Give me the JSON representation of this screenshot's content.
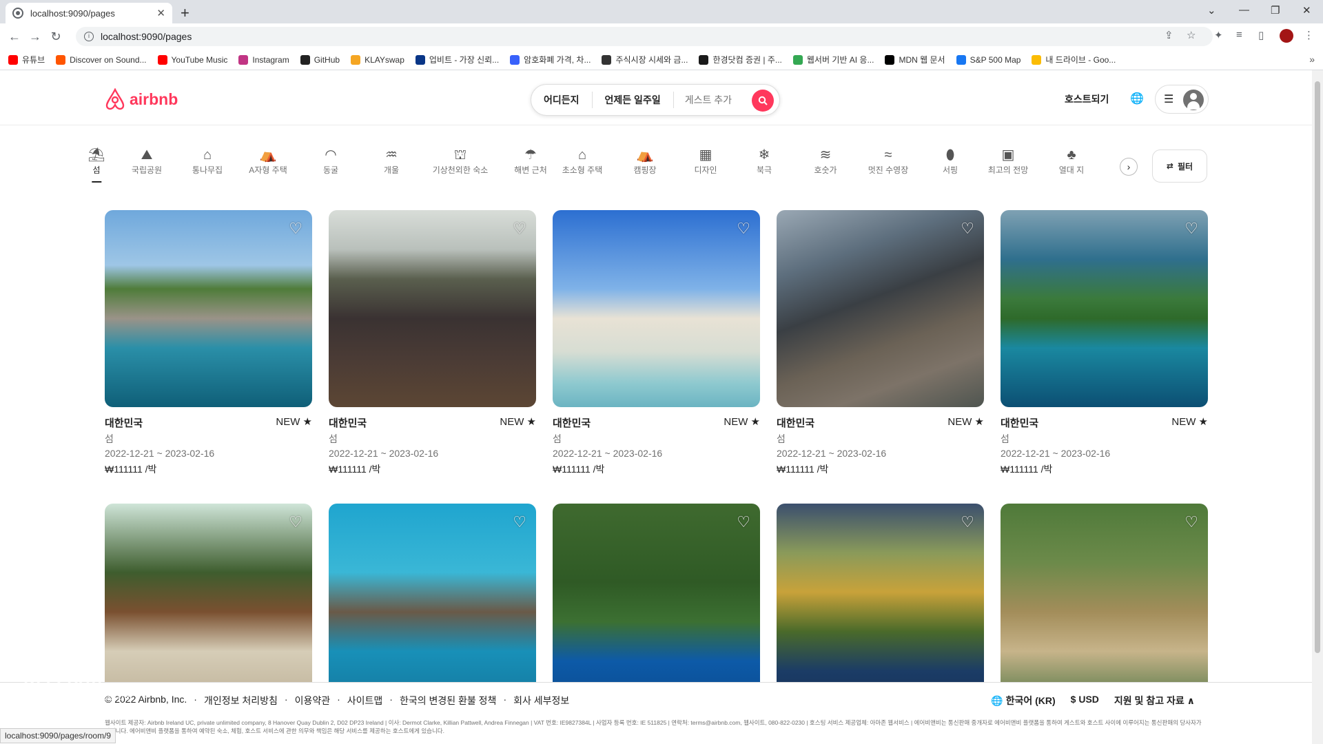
{
  "browser": {
    "tab_title": "localhost:9090/pages",
    "url": "localhost:9090/pages",
    "status_url": "localhost:9090/pages/room/9",
    "bookmarks": [
      {
        "label": "유튜브",
        "color": "#ff0000"
      },
      {
        "label": "Discover on Sound...",
        "color": "#ff5500"
      },
      {
        "label": "YouTube Music",
        "color": "#ff0000"
      },
      {
        "label": "Instagram",
        "color": "#c13584"
      },
      {
        "label": "GitHub",
        "color": "#222222"
      },
      {
        "label": "KLAYswap",
        "color": "#f5a623"
      },
      {
        "label": "업비트 - 가장 신뢰...",
        "color": "#093687"
      },
      {
        "label": "암호화폐 가격, 차...",
        "color": "#3861fb"
      },
      {
        "label": "주식시장 시세와 금...",
        "color": "#333333"
      },
      {
        "label": "한경닷컴 증권 | 주...",
        "color": "#1a1a1a"
      },
      {
        "label": "웹서버 기반 AI 응...",
        "color": "#34a853"
      },
      {
        "label": "MDN 웹 문서",
        "color": "#000000"
      },
      {
        "label": "S&P 500 Map",
        "color": "#1877f2"
      },
      {
        "label": "내 드라이브 - Goo...",
        "color": "#fbbc04"
      }
    ]
  },
  "header": {
    "logo": "airbnb",
    "search_where": "어디든지",
    "search_when": "언제든 일주일",
    "search_guest": "게스트 추가",
    "host_label": "호스트되기",
    "brand_color": "#ff385c"
  },
  "categories": [
    {
      "label": "섬",
      "icon": "⛱",
      "active": true
    },
    {
      "label": "국립공원",
      "icon": "⛰"
    },
    {
      "label": "통나무집",
      "icon": "⌂"
    },
    {
      "label": "A자형 주택",
      "icon": "⛺"
    },
    {
      "label": "동굴",
      "icon": "◠"
    },
    {
      "label": "개울",
      "icon": "♒"
    },
    {
      "label": "기상천외한 숙소",
      "icon": "⛫"
    },
    {
      "label": "해변 근처",
      "icon": "☂"
    },
    {
      "label": "초소형 주택",
      "icon": "⌂"
    },
    {
      "label": "캠핑장",
      "icon": "⛺"
    },
    {
      "label": "디자인",
      "icon": "▦"
    },
    {
      "label": "북극",
      "icon": "❄"
    },
    {
      "label": "호숫가",
      "icon": "≋"
    },
    {
      "label": "멋진 수영장",
      "icon": "≈"
    },
    {
      "label": "서핑",
      "icon": "⬮"
    },
    {
      "label": "최고의 전망",
      "icon": "▣"
    },
    {
      "label": "열대 지",
      "icon": "♣"
    }
  ],
  "filter_label": "필터",
  "listings": [
    {
      "location": "대한민국",
      "badge": "NEW ★",
      "type": "섬",
      "dates": "2022-12-21 ~ 2023-02-16",
      "price": "₩111111 /박",
      "bg": "linear-gradient(180deg,#6fa8dc 0%,#9ec6e6 28%,#4f7c3a 40%,#9a9388 55%,#2a8fa8 70%,#0f5f78 100%)"
    },
    {
      "location": "대한민국",
      "badge": "NEW ★",
      "type": "섬",
      "dates": "2022-12-21 ~ 2023-02-16",
      "price": "₩111111 /박",
      "bg": "linear-gradient(180deg,#d8ddd8 0%,#b9c0bb 20%,#5a5f4e 35%,#3a3232 55%,#4a3b35 75%,#5c4634 100%)"
    },
    {
      "location": "대한민국",
      "badge": "NEW ★",
      "type": "섬",
      "dates": "2022-12-21 ~ 2023-02-16",
      "price": "₩111111 /박",
      "bg": "linear-gradient(180deg,#2c6fd1 0%,#7fb2e8 40%,#e8e2d5 55%,#d7ddd3 72%,#8ec9cf 88%,#6bb4c2 100%)"
    },
    {
      "location": "대한민국",
      "badge": "NEW ★",
      "type": "섬",
      "dates": "2022-12-21 ~ 2023-02-16",
      "price": "₩111111 /박",
      "bg": "linear-gradient(160deg,#9aa8b4 0%,#5d6e7d 25%,#3a3f44 45%,#6b6256 65%,#7d7368 80%,#4f5550 100%)"
    },
    {
      "location": "대한민국",
      "badge": "NEW ★",
      "type": "섬",
      "dates": "2022-12-21 ~ 2023-02-16",
      "price": "₩111111 /박",
      "bg": "linear-gradient(180deg,#7fa1b3 0%,#2f6f8d 25%,#3b7a3c 45%,#2e6a2a 55%,#1a88a0 70%,#0c4f73 100%)"
    },
    {
      "location": "",
      "badge": "",
      "type": "",
      "dates": "",
      "price": "",
      "bg": "linear-gradient(180deg,#cfe5d8 0%,#3e5d2e 35%,#7a5030 55%,#d6cdb7 75%,#bfb39a 100%)"
    },
    {
      "location": "",
      "badge": "",
      "type": "",
      "dates": "",
      "price": "",
      "bg": "linear-gradient(180deg,#1fa5cf 0%,#3ab7d6 35%,#6a5a48 55%,#1890b8 75%,#147aa0 100%)"
    },
    {
      "location": "",
      "badge": "",
      "type": "",
      "dates": "",
      "price": "",
      "bg": "linear-gradient(180deg,#3f6a2f 0%,#2f5a25 40%,#3c7032 60%,#0d5aa8 80%,#0b4d92 100%)"
    },
    {
      "location": "",
      "badge": "",
      "type": "",
      "dates": "",
      "price": "",
      "bg": "linear-gradient(180deg,#3b4f6e 0%,#8a9a5a 25%,#c8a23a 45%,#4a6a2a 65%,#1b3c66 85%,#16325a 100%)"
    },
    {
      "location": "",
      "badge": "",
      "type": "",
      "dates": "",
      "price": "",
      "bg": "linear-gradient(180deg,#4f7a3a 0%,#6c8a4a 30%,#a38d5a 55%,#c7b48a 75%,#5a7a4a 100%)"
    }
  ],
  "footer": {
    "links": [
      "© 2022 Airbnb, Inc.",
      "·",
      "개인정보 처리방침",
      "·",
      "이용약관",
      "·",
      "사이트맵",
      "·",
      "한국의 변경된 환불 정책",
      "·",
      "회사 세부정보"
    ],
    "language": "🌐 한국어 (KR)",
    "currency": "$ USD",
    "support": "지원 및 참고 자료 ∧",
    "legal": "웹사이트 제공자: Airbnb Ireland UC, private unlimited company, 8 Hanover Quay Dublin 2, D02 DP23 Ireland | 이사: Dermot Clarke, Killian Pattwell, Andrea Finnegan | VAT 번호: IE9827384L | 사업자 등록 번호: IE 511825 | 연락처: terms@airbnb.com, 웹사이트, 080-822-0230 | 호스팅 서비스 제공업체: 아마존 웹서비스 | 에어비앤비는 통신판매 중개자로 에어비앤비 플랫폼을 통하여 게스트와 호스트 사이에 이루어지는 통신판매의 당사자가 아닙니다. 에어비앤비 플랫폼을 통하여 예약된 숙소, 체험, 호스트 서비스에 관한 의무와 책임은 해당 서비스를 제공하는 호스트에게 있습니다."
  },
  "watermark": {
    "title": "RecForth",
    "sub": "UHD Screen Recorder"
  }
}
